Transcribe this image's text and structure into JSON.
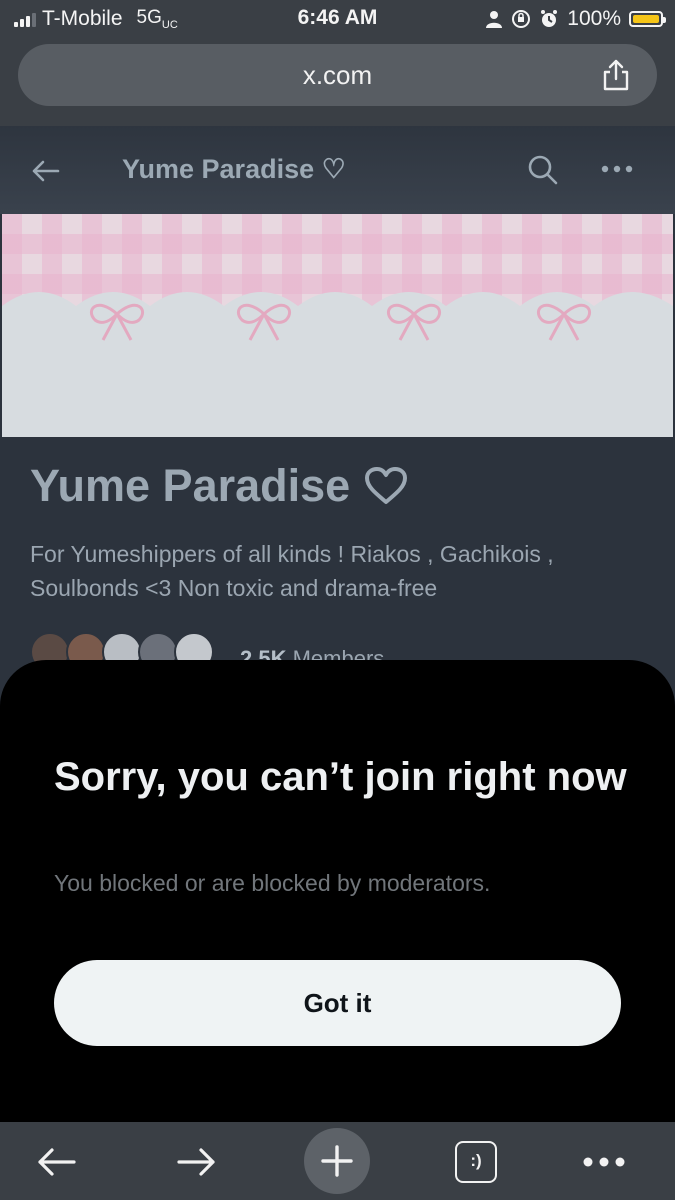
{
  "status_bar": {
    "carrier": "T-Mobile",
    "network": "5G",
    "network_suffix": "UC",
    "time": "6:46 AM",
    "battery": "100%",
    "battery_color": "#f5c518"
  },
  "browser": {
    "url": "x.com",
    "share_icon": "share-icon"
  },
  "header": {
    "title": "Yume Paradise ♡"
  },
  "community": {
    "name": "Yume Paradise",
    "description": "For Yumeshippers of all kinds ! Riakos , Gachikois , Soulbonds <3 Non toxic and drama-free",
    "member_count": "2.5K",
    "members_label": "Members"
  },
  "dialog": {
    "title": "Sorry, you can’t join right now",
    "message": "You blocked or are blocked by moderators.",
    "button_label": "Got it"
  },
  "bottom_bar": {
    "tabs_label": ":)"
  },
  "colors": {
    "page_bg": "#2c333d",
    "sheet_bg": "#000000",
    "button_bg": "#eff3f4",
    "chrome_bg": "#3a3f45"
  }
}
